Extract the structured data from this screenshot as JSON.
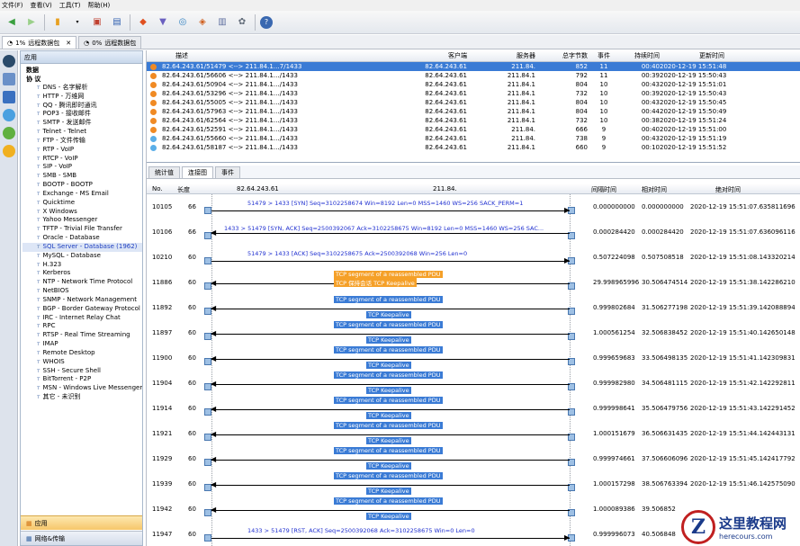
{
  "menu": [
    "文件(F)",
    "查看(V)",
    "工具(T)",
    "帮助(H)"
  ],
  "tabs": [
    {
      "pct": "1%",
      "label": "远程数据包"
    },
    {
      "pct": "0%",
      "label": "远程数据包"
    }
  ],
  "nav": {
    "header": "应用",
    "roots": [
      "数据",
      "协 议"
    ],
    "items": [
      "DNS - 名字解析",
      "HTTP - 万维网",
      "QQ - 腾讯即时通讯",
      "POP3 - 接收邮件",
      "SMTP - 发送邮件",
      "Telnet - Telnet",
      "FTP - 文件传输",
      "RTP - VoIP",
      "RTCP - VoIP",
      "SIP - VoIP",
      "SMB - SMB",
      "BOOTP - BOOTP",
      "Exchange - MS Email",
      "Quicktime",
      "X Windows",
      "Yahoo Messenger",
      "TFTP - Trivial File Transfer",
      "Oracle - Database",
      "SQL Server - Database (1962)",
      "MySQL - Database",
      "H.323",
      "Kerberos",
      "NTP - Network Time Protocol",
      "NetBIOS",
      "SNMP - Network Management",
      "BGP - Border Gateway Protocol",
      "IRC - Internet Relay Chat",
      "RPC",
      "RTSP - Real Time Streaming",
      "IMAP",
      "Remote Desktop",
      "WHOIS",
      "SSH - Secure Shell",
      "BitTorrent - P2P",
      "MSN - Windows Live Messenger",
      "其它 - 未识别"
    ],
    "footer_a": "应用",
    "footer_b": "网络&传输"
  },
  "grid": {
    "headers": [
      "描述",
      "客户端",
      "服务器",
      "总字节数",
      "事件",
      "持续时间",
      "更新时间"
    ],
    "rows": [
      {
        "desc": "82.64.243.61/51479 <--> 211.84.1…7/1433",
        "client": "82.64.243.61",
        "server": "211.84.",
        "bytes": "852",
        "events": "11",
        "dur": "00:40",
        "upd": "2020-12-19 15:51:48",
        "sel": true,
        "color": "#f08a24"
      },
      {
        "desc": "82.64.243.61/56606 <--> 211.84.1…/1433",
        "client": "82.64.243.61",
        "server": "211.84.1",
        "bytes": "792",
        "events": "11",
        "dur": "00:39",
        "upd": "2020-12-19 15:50:43",
        "sel": false,
        "color": "#f08a24"
      },
      {
        "desc": "82.64.243.61/50904 <--> 211.84.1…/1433",
        "client": "82.64.243.61",
        "server": "211.84.1",
        "bytes": "804",
        "events": "10",
        "dur": "00:43",
        "upd": "2020-12-19 15:51:01",
        "sel": false,
        "color": "#f08a24"
      },
      {
        "desc": "82.64.243.61/53296 <--> 211.84.1…/1433",
        "client": "82.64.243.61",
        "server": "211.84.1",
        "bytes": "732",
        "events": "10",
        "dur": "00:39",
        "upd": "2020-12-19 15:50:43",
        "sel": false,
        "color": "#f08a24"
      },
      {
        "desc": "82.64.243.61/55005 <--> 211.84.1…/1433",
        "client": "82.64.243.61",
        "server": "211.84.1",
        "bytes": "804",
        "events": "10",
        "dur": "00:43",
        "upd": "2020-12-19 15:50:45",
        "sel": false,
        "color": "#f08a24"
      },
      {
        "desc": "82.64.243.61/57963 <--> 211.84.1…/1433",
        "client": "82.64.243.61",
        "server": "211.84.1",
        "bytes": "804",
        "events": "10",
        "dur": "00:44",
        "upd": "2020-12-19 15:50:49",
        "sel": false,
        "color": "#f08a24"
      },
      {
        "desc": "82.64.243.61/62564 <--> 211.84.1…/1433",
        "client": "82.64.243.61",
        "server": "211.84.1",
        "bytes": "732",
        "events": "10",
        "dur": "00:38",
        "upd": "2020-12-19 15:51:24",
        "sel": false,
        "color": "#f08a24"
      },
      {
        "desc": "82.64.243.61/52591 <--> 211.84.1…/1433",
        "client": "82.64.243.61",
        "server": "211.84.",
        "bytes": "666",
        "events": "9",
        "dur": "00:40",
        "upd": "2020-12-19 15:51:00",
        "sel": false,
        "color": "#f08a24"
      },
      {
        "desc": "82.64.243.61/55660 <--> 211.84.1…/1433",
        "client": "82.64.243.61",
        "server": "211.84.",
        "bytes": "738",
        "events": "9",
        "dur": "00:43",
        "upd": "2020-12-19 15:51:19",
        "sel": false,
        "color": "#5aaee8"
      },
      {
        "desc": "82.64.243.61/58187 <--> 211.84.1…/1433",
        "client": "82.64.243.61",
        "server": "211.84.1",
        "bytes": "660",
        "events": "9",
        "dur": "00:10",
        "upd": "2020-12-19 15:51:52",
        "sel": false,
        "color": "#5aaee8"
      }
    ]
  },
  "subtabs": [
    "统计值",
    "连接图",
    "事件"
  ],
  "flow": {
    "headers": [
      "No.",
      "长度",
      "82.64.243.61",
      "211.84.",
      "间隔时间",
      "相对时间",
      "绝对时间"
    ],
    "rows": [
      {
        "no": "10105",
        "len": "66",
        "dir": "right",
        "msg": "51479 > 1433 [SYN] Seq=3102258674 Win=8192 Len=0 MSS=1460 WS=256 SACK_PERM=1",
        "tag1": "",
        "tag2": "",
        "tagc": "",
        "gap": "0.000000000",
        "rel": "0.000000000",
        "abs": "2020-12-19 15:51:07.635811696"
      },
      {
        "no": "10106",
        "len": "66",
        "dir": "left",
        "msg": "1433 > 51479 [SYN, ACK] Seq=2500392067 Ack=3102258675 Win=8192 Len=0 MSS=1460 WS=256 SAC...",
        "tag1": "",
        "tag2": "",
        "tagc": "",
        "gap": "0.000284420",
        "rel": "0.000284420",
        "abs": "2020-12-19 15:51:07.636096116"
      },
      {
        "no": "10210",
        "len": "60",
        "dir": "right",
        "msg": "51479 > 1433 [ACK] Seq=3102258675 Ack=2500392068 Win=256 Len=0",
        "tag1": "",
        "tag2": "",
        "tagc": "",
        "gap": "0.507224098",
        "rel": "0.507508518",
        "abs": "2020-12-19 15:51:08.143320214"
      },
      {
        "no": "11886",
        "len": "60",
        "dir": "left",
        "msg": "",
        "tag1": "TCP segment of a reassembled PDU",
        "tag2": "TCP 保持会话 TCP Keepalive",
        "tagc": "o",
        "gap": "29.998965996",
        "rel": "30.506474514",
        "abs": "2020-12-19 15:51:38.142286210"
      },
      {
        "no": "11892",
        "len": "60",
        "dir": "left",
        "msg": "",
        "tag1": "TCP segment of a reassembled PDU",
        "tag2": "TCP Keepalive",
        "tagc": "",
        "gap": "0.999802684",
        "rel": "31.506277198",
        "abs": "2020-12-19 15:51:39.142088894"
      },
      {
        "no": "11897",
        "len": "60",
        "dir": "left",
        "msg": "",
        "tag1": "TCP segment of a reassembled PDU",
        "tag2": "TCP Keepalive",
        "tagc": "",
        "gap": "1.000561254",
        "rel": "32.506838452",
        "abs": "2020-12-19 15:51:40.142650148"
      },
      {
        "no": "11900",
        "len": "60",
        "dir": "left",
        "msg": "",
        "tag1": "TCP segment of a reassembled PDU",
        "tag2": "TCP Keepalive",
        "tagc": "",
        "gap": "0.999659683",
        "rel": "33.506498135",
        "abs": "2020-12-19 15:51:41.142309831"
      },
      {
        "no": "11904",
        "len": "60",
        "dir": "left",
        "msg": "",
        "tag1": "TCP segment of a reassembled PDU",
        "tag2": "TCP Keepalive",
        "tagc": "",
        "gap": "0.999982980",
        "rel": "34.506481115",
        "abs": "2020-12-19 15:51:42.142292811"
      },
      {
        "no": "11914",
        "len": "60",
        "dir": "left",
        "msg": "",
        "tag1": "TCP segment of a reassembled PDU",
        "tag2": "TCP Keepalive",
        "tagc": "",
        "gap": "0.999998641",
        "rel": "35.506479756",
        "abs": "2020-12-19 15:51:43.142291452"
      },
      {
        "no": "11921",
        "len": "60",
        "dir": "left",
        "msg": "",
        "tag1": "TCP segment of a reassembled PDU",
        "tag2": "TCP Keepalive",
        "tagc": "",
        "gap": "1.000151679",
        "rel": "36.506631435",
        "abs": "2020-12-19 15:51:44.142443131"
      },
      {
        "no": "11929",
        "len": "60",
        "dir": "left",
        "msg": "",
        "tag1": "TCP segment of a reassembled PDU",
        "tag2": "TCP Keepalive",
        "tagc": "",
        "gap": "0.999974661",
        "rel": "37.506606096",
        "abs": "2020-12-19 15:51:45.142417792"
      },
      {
        "no": "11939",
        "len": "60",
        "dir": "left",
        "msg": "",
        "tag1": "TCP segment of a reassembled PDU",
        "tag2": "TCP Keepalive",
        "tagc": "",
        "gap": "1.000157298",
        "rel": "38.506763394",
        "abs": "2020-12-19 15:51:46.142575090"
      },
      {
        "no": "11942",
        "len": "60",
        "dir": "left",
        "msg": "",
        "tag1": "TCP segment of a reassembled PDU",
        "tag2": "TCP Keepalive",
        "tagc": "",
        "gap": "1.000089386",
        "rel": "39.506852",
        "abs": ""
      },
      {
        "no": "11947",
        "len": "60",
        "dir": "right",
        "msg": "1433 > 51479 [RST, ACK] Seq=2500392068 Ack=3102258675 Win=0 Len=0",
        "tag1": "",
        "tag2": "",
        "tagc": "",
        "gap": "0.999996073",
        "rel": "40.506848",
        "abs": ""
      }
    ]
  },
  "watermark": {
    "logo": "Z",
    "cn": "这里教程网",
    "url": "herecours.com"
  }
}
